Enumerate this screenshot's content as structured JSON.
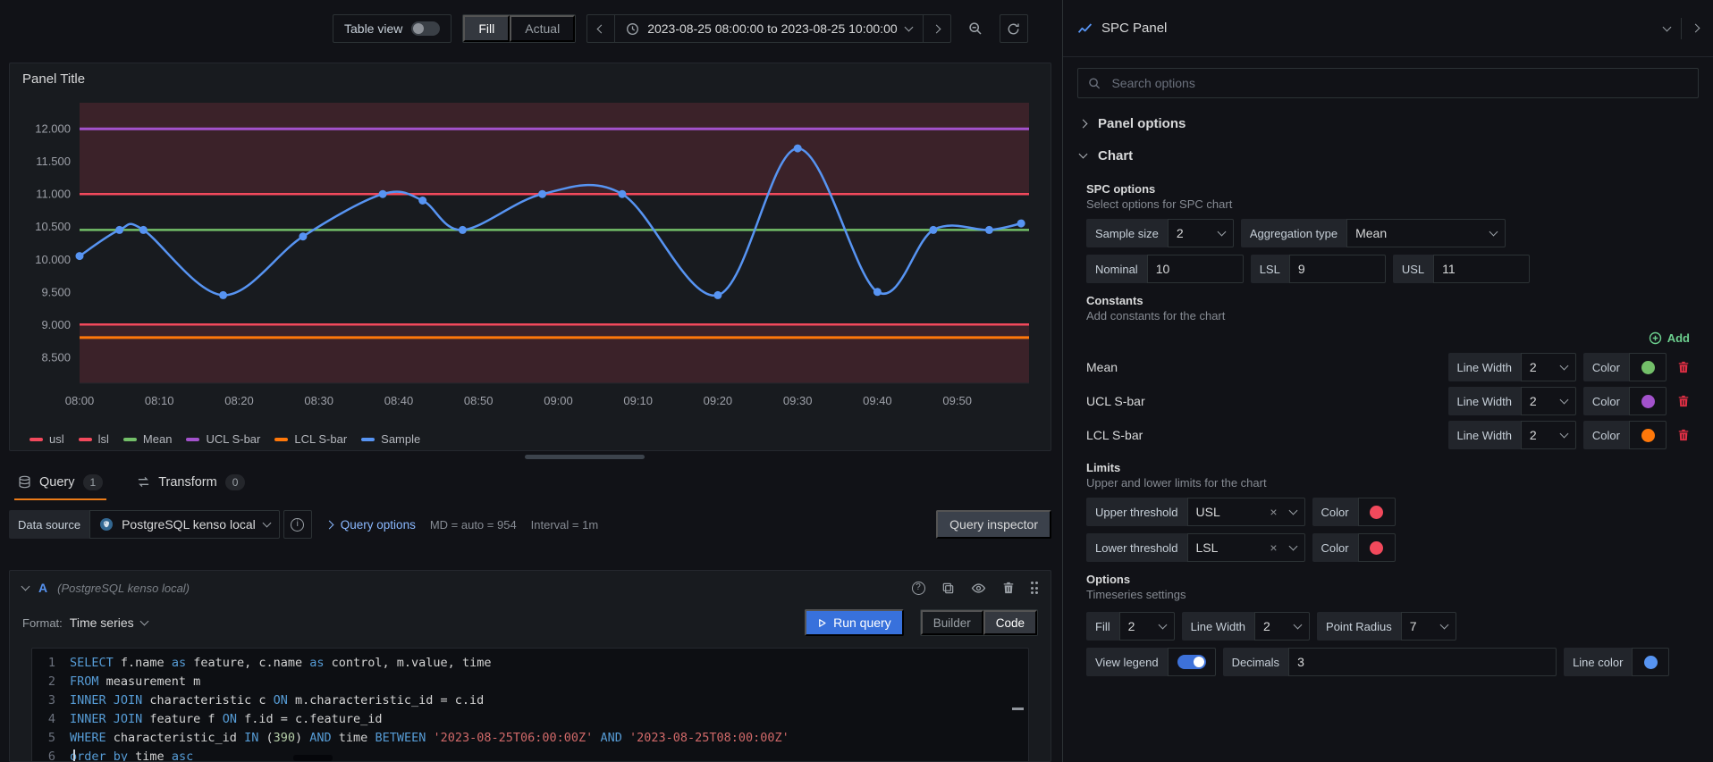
{
  "toolbar": {
    "table_view_label": "Table view",
    "fill_label": "Fill",
    "actual_label": "Actual",
    "time_range_text": "2023-08-25 08:00:00 to 2023-08-25 10:00:00"
  },
  "panel_header": {
    "title": "SPC Panel"
  },
  "viz": {
    "title": "Panel Title"
  },
  "chart_data": {
    "type": "line",
    "title": "Panel Title",
    "x_tick_labels": [
      "08:00",
      "08:10",
      "08:20",
      "08:30",
      "08:40",
      "08:50",
      "09:00",
      "09:10",
      "09:20",
      "09:30",
      "09:40",
      "09:50"
    ],
    "x_tick_minutes": [
      0,
      10,
      20,
      30,
      40,
      50,
      60,
      70,
      80,
      90,
      100,
      110
    ],
    "x_domain_minutes": [
      0,
      119
    ],
    "y_tick_values": [
      8.5,
      9,
      9.5,
      10,
      10.5,
      11,
      11.5,
      12
    ],
    "y_tick_labels": [
      "8.500",
      "9.000",
      "9.500",
      "10.000",
      "10.500",
      "11.000",
      "11.500",
      "12.000"
    ],
    "y_domain": [
      8.1,
      12.4
    ],
    "grid": false,
    "legend_position": "bottom",
    "out_of_range_fill": "rgba(242,73,92,0.16)",
    "shaded_regions": [
      {
        "from": 11.0,
        "to": 12.4
      },
      {
        "from": 8.1,
        "to": 9.0
      }
    ],
    "reference_lines": [
      {
        "name": "UCL S-bar",
        "value": 12.0,
        "color": "#a352cc",
        "width": 3
      },
      {
        "name": "usl",
        "value": 11.0,
        "color": "#f2495c",
        "width": 2.5
      },
      {
        "name": "Mean",
        "value": 10.45,
        "color": "#73bf69",
        "width": 2.5
      },
      {
        "name": "lsl",
        "value": 9.0,
        "color": "#f2495c",
        "width": 2.5
      },
      {
        "name": "LCL S-bar",
        "value": 8.8,
        "color": "#ff780a",
        "width": 3
      }
    ],
    "series": [
      {
        "name": "Sample",
        "color": "#5794f2",
        "points_min_value": [
          [
            0,
            10.05
          ],
          [
            5,
            10.45
          ],
          [
            8,
            10.45
          ],
          [
            18,
            9.45
          ],
          [
            28,
            10.35
          ],
          [
            38,
            11.0
          ],
          [
            43,
            10.9
          ],
          [
            48,
            10.45
          ],
          [
            58,
            11.0
          ],
          [
            68,
            11.0
          ],
          [
            80,
            9.45
          ],
          [
            90,
            11.7
          ],
          [
            100,
            9.5
          ],
          [
            107,
            10.45
          ],
          [
            114,
            10.45
          ],
          [
            118,
            10.55
          ]
        ]
      }
    ],
    "legend": [
      {
        "label": "usl",
        "color": "#f2495c"
      },
      {
        "label": "lsl",
        "color": "#f2495c"
      },
      {
        "label": "Mean",
        "color": "#73bf69"
      },
      {
        "label": "UCL S-bar",
        "color": "#a352cc"
      },
      {
        "label": "LCL S-bar",
        "color": "#ff780a"
      },
      {
        "label": "Sample",
        "color": "#5794f2"
      }
    ]
  },
  "tabs": {
    "query_label": "Query",
    "query_count": "1",
    "transform_label": "Transform",
    "transform_count": "0"
  },
  "ds_row": {
    "data_source_label": "Data source",
    "datasource_name": "PostgreSQL kenso local",
    "query_options_label": "Query options",
    "md_text": "MD = auto = 954",
    "interval_text": "Interval = 1m",
    "query_inspector_label": "Query inspector"
  },
  "query": {
    "ref_id": "A",
    "ds_hint": "(PostgreSQL kenso local)",
    "format_label": "Format:",
    "format_value": "Time series",
    "run_label": "Run query",
    "builder_label": "Builder",
    "code_label": "Code",
    "sql_lines": [
      [
        [
          "k",
          "SELECT"
        ],
        [
          "p",
          " f.name "
        ],
        [
          "k",
          "as"
        ],
        [
          "p",
          " feature, c.name "
        ],
        [
          "k",
          "as"
        ],
        [
          "p",
          " control, m.value, time"
        ]
      ],
      [
        [
          "k",
          "FROM"
        ],
        [
          "p",
          " measurement m"
        ]
      ],
      [
        [
          "k",
          "INNER JOIN"
        ],
        [
          "p",
          " characteristic c "
        ],
        [
          "k",
          "ON"
        ],
        [
          "p",
          " m.characteristic_id = c.id"
        ]
      ],
      [
        [
          "k",
          "INNER JOIN"
        ],
        [
          "p",
          " feature f "
        ],
        [
          "k",
          "ON"
        ],
        [
          "p",
          " f.id = c.feature_id"
        ]
      ],
      [
        [
          "k",
          "WHERE"
        ],
        [
          "p",
          " characteristic_id "
        ],
        [
          "k",
          "IN"
        ],
        [
          "p",
          " ("
        ],
        [
          "n",
          "390"
        ],
        [
          "p",
          ") "
        ],
        [
          "k",
          "AND"
        ],
        [
          "p",
          " time "
        ],
        [
          "k",
          "BETWEEN"
        ],
        [
          "p",
          " "
        ],
        [
          "s",
          "'2023-08-25T06:00:00Z'"
        ],
        [
          "p",
          " "
        ],
        [
          "k",
          "AND"
        ],
        [
          "p",
          " "
        ],
        [
          "s",
          "'2023-08-25T08:00:00Z'"
        ]
      ],
      [
        [
          "k",
          "order"
        ],
        [
          "p",
          " "
        ],
        [
          "k",
          "by"
        ],
        [
          "p",
          " time "
        ],
        [
          "k",
          "asc"
        ]
      ]
    ]
  },
  "opts": {
    "search_placeholder": "Search options",
    "panel_options_label": "Panel options",
    "chart_label": "Chart",
    "spc_title": "SPC options",
    "spc_desc": "Select options for SPC chart",
    "sample_size_label": "Sample size",
    "sample_size_value": "2",
    "aggregation_label": "Aggregation type",
    "aggregation_value": "Mean",
    "nominal_label": "Nominal",
    "nominal_value": "10",
    "lsl_label": "LSL",
    "lsl_value": "9",
    "usl_label": "USL",
    "usl_value": "11",
    "constants_title": "Constants",
    "constants_desc": "Add constants for the chart",
    "add_label": "Add",
    "line_width_label": "Line Width",
    "color_label": "Color",
    "constants": [
      {
        "name": "Mean",
        "line_width": "2",
        "color": "#73bf69"
      },
      {
        "name": "UCL S-bar",
        "line_width": "2",
        "color": "#a352cc"
      },
      {
        "name": "LCL S-bar",
        "line_width": "2",
        "color": "#ff780a"
      }
    ],
    "limits_title": "Limits",
    "limits_desc": "Upper and lower limits for the chart",
    "upper_threshold_label": "Upper threshold",
    "upper_threshold_value": "USL",
    "upper_color": "#f2495c",
    "lower_threshold_label": "Lower threshold",
    "lower_threshold_value": "LSL",
    "lower_color": "#f2495c",
    "options_title": "Options",
    "options_desc": "Timeseries settings",
    "fill_label": "Fill",
    "fill_value": "2",
    "ts_line_width_label": "Line Width",
    "ts_line_width_value": "2",
    "point_radius_label": "Point Radius",
    "point_radius_value": "7",
    "view_legend_label": "View legend",
    "decimals_label": "Decimals",
    "decimals_value": "3",
    "line_color_label": "Line color",
    "line_color": "#5794f2"
  },
  "icons": {
    "close": "×",
    "help": "?",
    "info": "i",
    "search": "magnifier",
    "clock": "clock-face",
    "zoom_out": "magnifier-minus",
    "refresh": "circular-arrow",
    "database": "cylinder",
    "transform": "arrows",
    "trash": "trash-can",
    "eye": "eye",
    "copy": "two-rects",
    "drag": "six-dots",
    "play": "triangle",
    "add": "plus-circle",
    "spc_panel": "sparkline"
  }
}
